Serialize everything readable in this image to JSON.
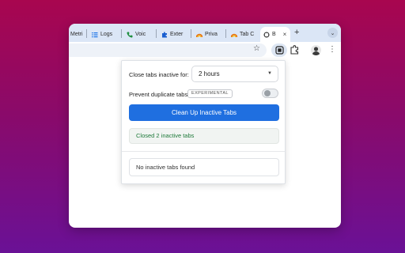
{
  "browser": {
    "tabs": [
      {
        "label": "Metri",
        "icon": "metrics-icon"
      },
      {
        "label": "Logs",
        "icon": "list-icon"
      },
      {
        "label": "Voic",
        "icon": "phone-icon"
      },
      {
        "label": "Exter",
        "icon": "puzzle-icon"
      },
      {
        "label": "Priva",
        "icon": "arc-icon"
      },
      {
        "label": "Tab C",
        "icon": "arc-icon"
      },
      {
        "label": "B",
        "icon": "extension-icon",
        "active": true
      }
    ],
    "tab_close": "×",
    "new_tab": "+",
    "tab_dropdown": "⌄",
    "star": "☆",
    "menu": "⋮"
  },
  "popup": {
    "inactive_label": "Close tabs inactive for:",
    "inactive_value": "2 hours",
    "duplicate_label": "Prevent duplicate tabs",
    "experimental_badge": "EXPERIMENTAL",
    "duplicate_enabled": false,
    "cleanup_button": "Clean Up Inactive Tabs",
    "status_text": "Closed 2 inactive tabs",
    "empty_text": "No inactive tabs found"
  },
  "colors": {
    "primary": "#1f6fe0",
    "success_text": "#1e7a3a",
    "tabstrip": "#dbe6f6"
  }
}
